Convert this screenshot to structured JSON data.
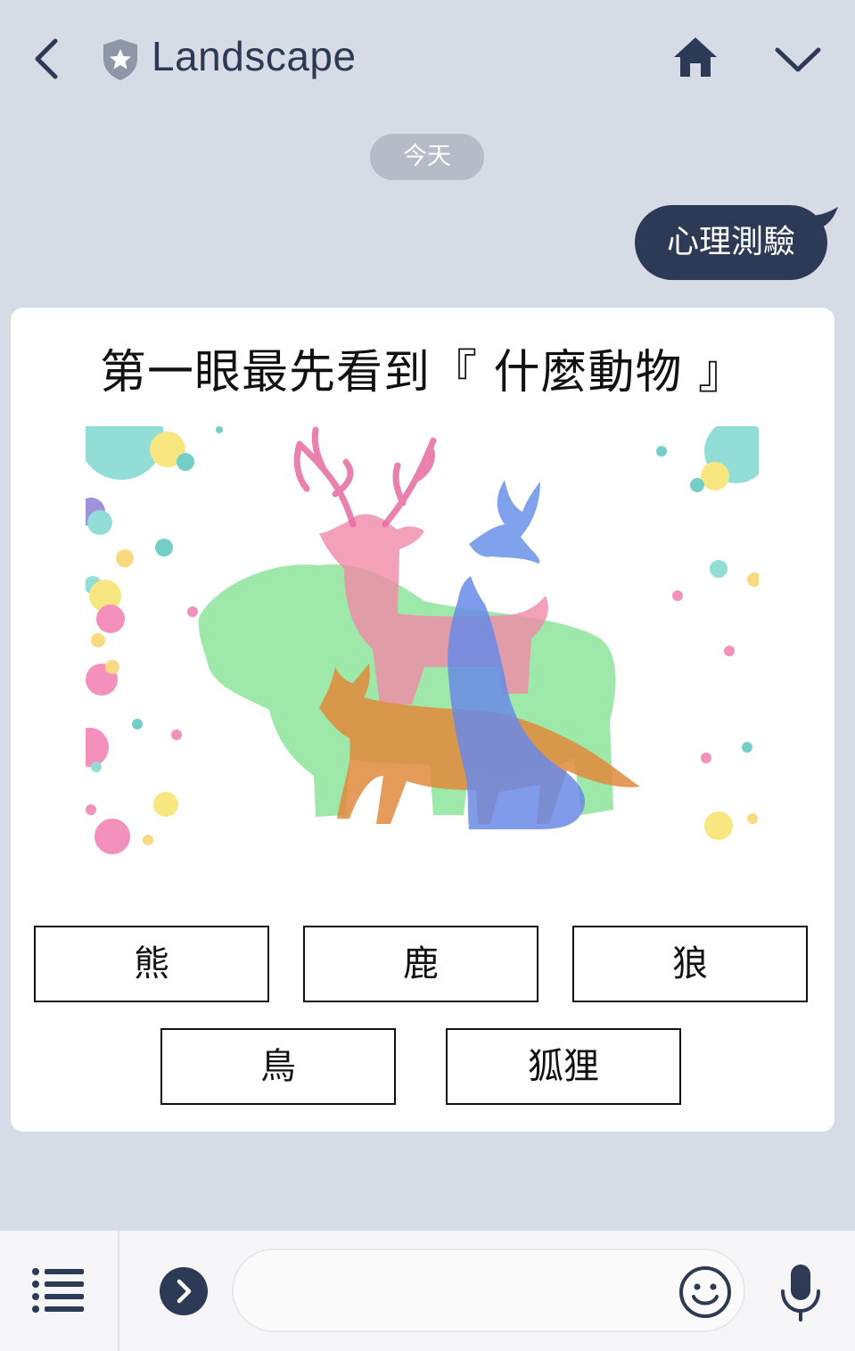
{
  "header": {
    "back_icon": "chevron-left-icon",
    "badge_icon": "shield-star-icon",
    "title": "Landscape",
    "home_icon": "home-icon",
    "menu_icon": "chevron-down-icon"
  },
  "chat": {
    "date_label": "今天",
    "outgoing_message": "心理測驗",
    "card": {
      "title": "第一眼最先看到『 什麼動物 』",
      "image": "watercolor-animal-silhouettes",
      "options": [
        "熊",
        "鹿",
        "狼",
        "鳥",
        "狐狸"
      ]
    }
  },
  "input_bar": {
    "menu_icon": "list-icon",
    "expand_icon": "chevron-right-circle-icon",
    "message_value": "",
    "message_placeholder": "",
    "emoji_icon": "smiley-icon",
    "mic_icon": "microphone-icon"
  },
  "colors": {
    "background": "#d7dbe5",
    "header_text": "#2d3a55",
    "bubble": "#2d3a55",
    "date_pill": "#b5bcc8"
  }
}
